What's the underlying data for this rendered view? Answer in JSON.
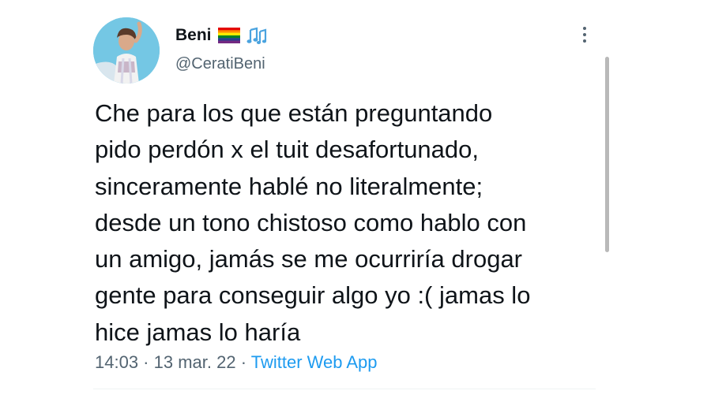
{
  "author": {
    "display_name": "Beni",
    "handle": "@CeratiBeni",
    "name_emojis": [
      "rainbow-flag",
      "musical-notes"
    ]
  },
  "tweet": {
    "text": "Che para los que están preguntando\npido perdón x el tuit desafortunado,\nsinceramente hablé no literalmente;\ndesde un tono chistoso como hablo con\nun amigo, jamás se me ocurriría drogar\ngente para conseguir algo yo :( jamas lo\nhice jamas lo haría",
    "time": "14:03",
    "separator": " · ",
    "date": "13 mar. 22",
    "source": "Twitter Web App"
  },
  "colors": {
    "text": "#0f1419",
    "secondary": "#536471",
    "link": "#1d9bf0",
    "scrollbar": "#b9b9b9"
  },
  "icons": {
    "more": "more-vertical-icon"
  }
}
